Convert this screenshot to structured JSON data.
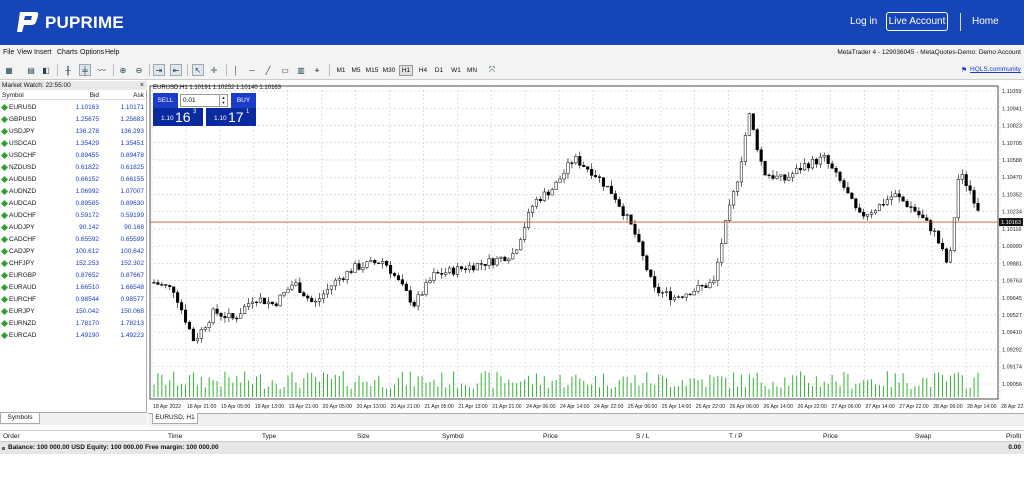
{
  "header": {
    "brand": "PUPRIME",
    "login": "Log in",
    "live_account": "Live Account",
    "home": "Home"
  },
  "menu": [
    "File",
    "View",
    "Insert",
    "Charts",
    "Options",
    "Help"
  ],
  "terminal_title": "MetaTrader 4 - 129036045 - MetaQuotes-Demo: Demo Account",
  "toolbar": {
    "timeframes": [
      "M1",
      "M5",
      "M15",
      "M30",
      "H1",
      "H4",
      "D1",
      "W1",
      "MN"
    ],
    "active_timeframe": "H1",
    "hqls": "HQLS.community"
  },
  "market_watch": {
    "title": "Market Watch: 22:55:00",
    "close": "×",
    "columns": {
      "symbol": "Symbol",
      "bid": "Bid",
      "ask": "Ask"
    },
    "rows": [
      {
        "symbol": "EURUSD",
        "bid": "1.10163",
        "ask": "1.10171"
      },
      {
        "symbol": "GBPUSD",
        "bid": "1.25675",
        "ask": "1.25683"
      },
      {
        "symbol": "USDJPY",
        "bid": "136.278",
        "ask": "136.293"
      },
      {
        "symbol": "USDCAD",
        "bid": "1.35429",
        "ask": "1.35451"
      },
      {
        "symbol": "USDCHF",
        "bid": "0.89455",
        "ask": "0.89478"
      },
      {
        "symbol": "NZDUSD",
        "bid": "0.61822",
        "ask": "0.61825"
      },
      {
        "symbol": "AUDUSD",
        "bid": "0.66152",
        "ask": "0.66155"
      },
      {
        "symbol": "AUDNZD",
        "bid": "1.06992",
        "ask": "1.07007"
      },
      {
        "symbol": "AUDCAD",
        "bid": "0.89585",
        "ask": "0.89630"
      },
      {
        "symbol": "AUDCHF",
        "bid": "0.59172",
        "ask": "0.59199"
      },
      {
        "symbol": "AUDJPY",
        "bid": "90.142",
        "ask": "90.168"
      },
      {
        "symbol": "CADCHF",
        "bid": "0.65592",
        "ask": "0.65599"
      },
      {
        "symbol": "CADJPY",
        "bid": "100.612",
        "ask": "100.642"
      },
      {
        "symbol": "CHFJPY",
        "bid": "152.253",
        "ask": "152.302"
      },
      {
        "symbol": "EURGBP",
        "bid": "0.87652",
        "ask": "0.87667"
      },
      {
        "symbol": "EURAUD",
        "bid": "1.66510",
        "ask": "1.66548"
      },
      {
        "symbol": "EURCHF",
        "bid": "0.98544",
        "ask": "0.98577"
      },
      {
        "symbol": "EURJPY",
        "bid": "150.042",
        "ask": "150.068"
      },
      {
        "symbol": "EURNZD",
        "bid": "1.78170",
        "ask": "1.78213"
      },
      {
        "symbol": "EURCAD",
        "bid": "1.49190",
        "ask": "1.49223"
      }
    ],
    "tab": "Symbols"
  },
  "chart": {
    "info": "EURUSD,H1  1.10191 1.10252 1.10140 1.10163",
    "tab": "EURUSD, H1",
    "current_price": "1.10163",
    "price_labels": [
      "1.11059",
      "1.10941",
      "1.10823",
      "1.10705",
      "1.10588",
      "1.10470",
      "1.10352",
      "1.10234",
      "1.10116",
      "1.09999",
      "1.09881",
      "1.09763",
      "1.09645",
      "1.09527",
      "1.09410",
      "1.09292",
      "1.09174",
      "1.09056"
    ],
    "time_labels": [
      "18 Apr 2022",
      "18 Apr 21:00",
      "19 Apr 05:00",
      "19 Apr 13:00",
      "19 Apr 21:00",
      "20 Apr 05:00",
      "20 Apr 13:00",
      "20 Apr 21:00",
      "21 Apr 05:00",
      "21 Apr 13:00",
      "21 Apr 21:00",
      "24 Apr 06:00",
      "24 Apr 14:00",
      "24 Apr 22:00",
      "25 Apr 06:00",
      "25 Apr 14:00",
      "25 Apr 22:00",
      "26 Apr 06:00",
      "26 Apr 14:00",
      "26 Apr 22:00",
      "27 Apr 06:00",
      "27 Apr 14:00",
      "27 Apr 22:00",
      "28 Apr 06:00",
      "28 Apr 14:00",
      "28 Apr 22:00"
    ]
  },
  "one_click": {
    "sell": "SELL",
    "buy": "BUY",
    "lot": "0.01",
    "sell_small": "1.10",
    "sell_big": "16",
    "sell_sup": "3",
    "buy_small": "1.10",
    "buy_big": "17",
    "buy_sup": "1"
  },
  "terminal": {
    "columns": [
      "Order",
      "Time",
      "Type",
      "Size",
      "Symbol",
      "Price",
      "S / L",
      "T / P",
      "Price",
      "Swap",
      "Profit"
    ],
    "balance": "Balance: 100 000.00 USD  Equity: 100 000.00  Free margin: 100 000.00",
    "profit": "0.00"
  },
  "colors": {
    "brand": "#1645b8",
    "accent_blue": "#1a3cc8",
    "price_line": "#c8542a"
  }
}
